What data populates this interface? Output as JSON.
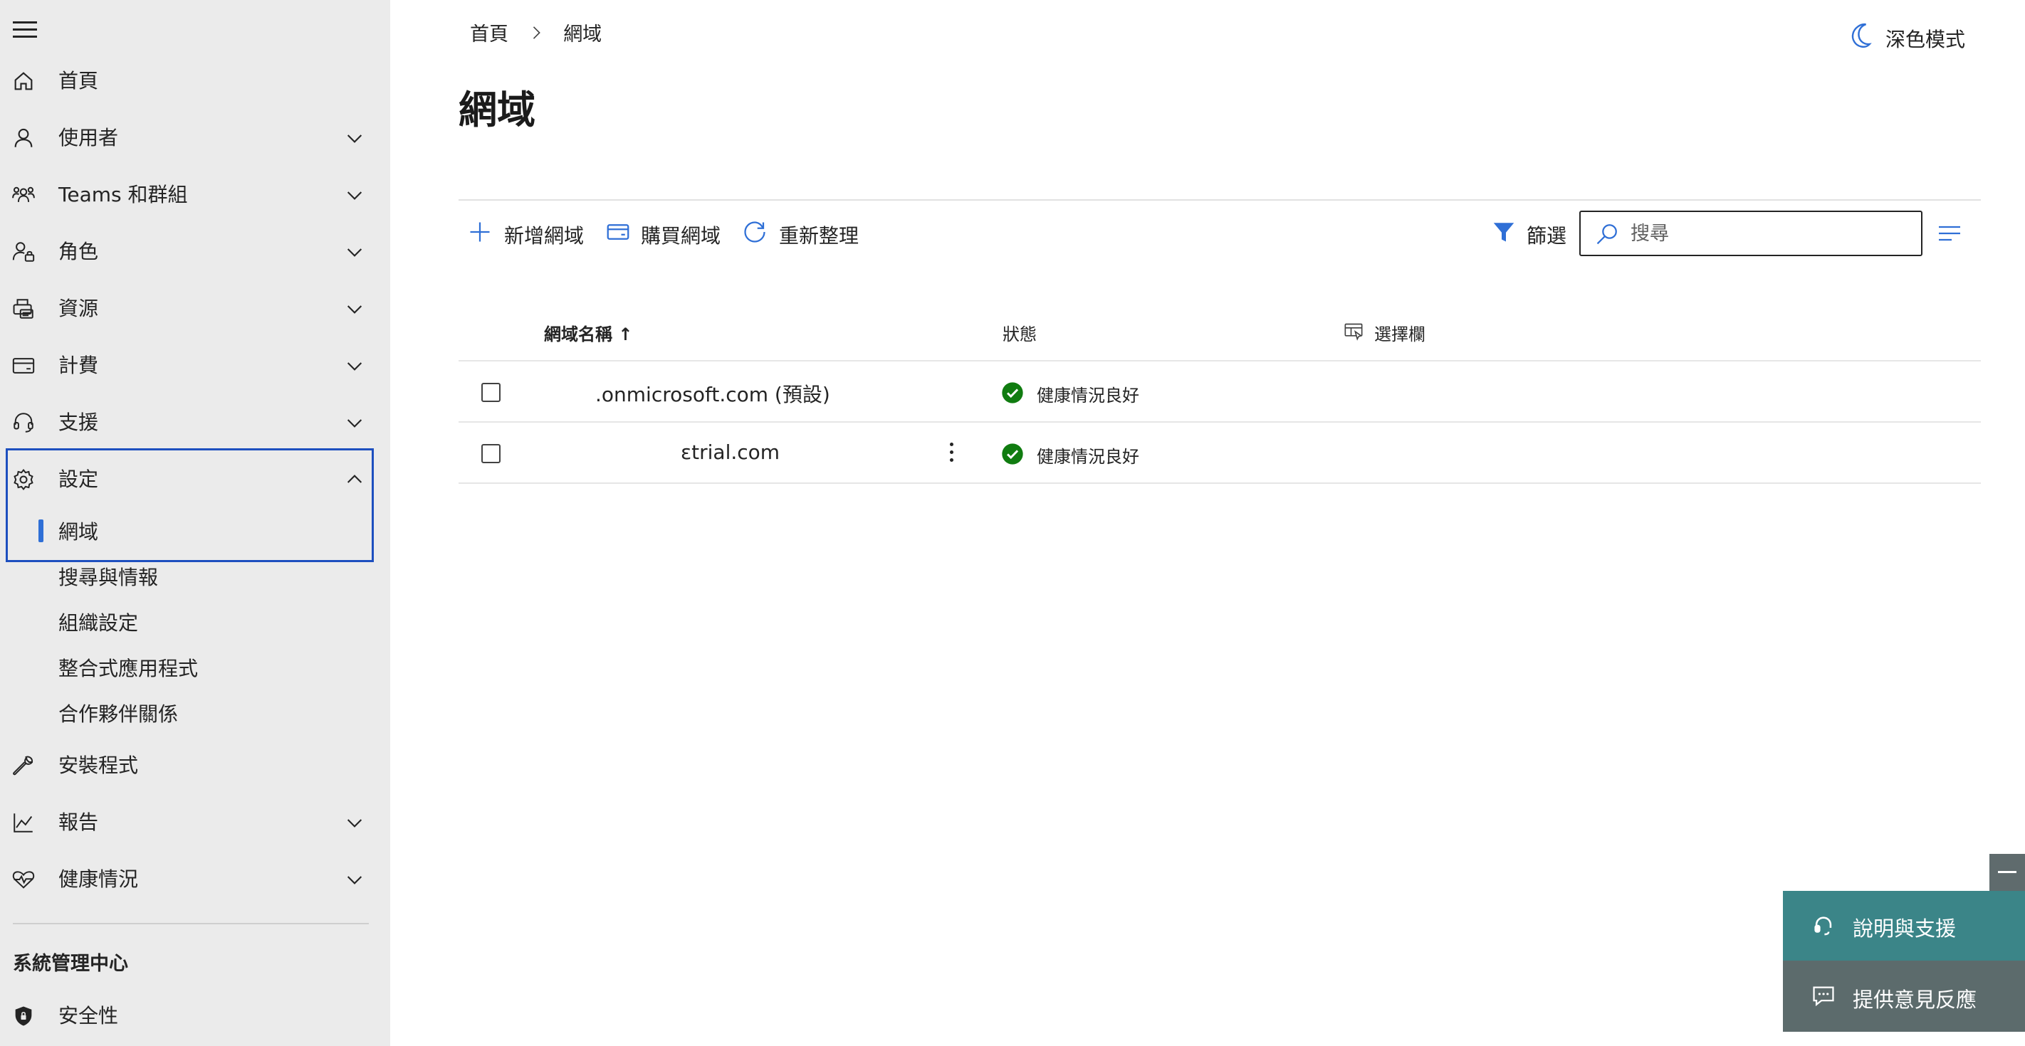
{
  "sidebar": {
    "items": [
      {
        "label": "首頁"
      },
      {
        "label": "使用者"
      },
      {
        "label": "Teams 和群組"
      },
      {
        "label": "角色"
      },
      {
        "label": "資源"
      },
      {
        "label": "計費"
      },
      {
        "label": "支援"
      },
      {
        "label": "設定"
      },
      {
        "label": "安裝程式"
      },
      {
        "label": "報告"
      },
      {
        "label": "健康情況"
      }
    ],
    "settings_sub": [
      {
        "label": "網域",
        "selected": true
      },
      {
        "label": "搜尋與情報"
      },
      {
        "label": "組織設定"
      },
      {
        "label": "整合式應用程式"
      },
      {
        "label": "合作夥伴關係"
      }
    ],
    "section_title": "系統管理中心",
    "section_items": [
      {
        "label": "安全性"
      }
    ]
  },
  "breadcrumb": [
    "首頁",
    "網域"
  ],
  "header": {
    "dark_mode_label": "深色模式"
  },
  "page": {
    "title": "網域"
  },
  "toolbar": {
    "add_label": "新增網域",
    "buy_label": "購買網域",
    "refresh_label": "重新整理",
    "filter_label": "篩選",
    "search_placeholder": "搜尋"
  },
  "table": {
    "columns": {
      "name": "網域名稱 ↑",
      "status": "狀態",
      "choose": "選擇欄"
    },
    "rows": [
      {
        "name": ".onmicrosoft.com (預設)",
        "status": "健康情況良好"
      },
      {
        "name": "ɛtrial.com",
        "status": "健康情況良好"
      }
    ]
  },
  "floating": {
    "help_label": "說明與支援",
    "feedback_label": "提供意見反應"
  },
  "colors": {
    "sidebar_bg": "#ebebeb",
    "accent_blue": "#2f6fd6",
    "focus_outline": "#1d4fbf",
    "success_green": "#107c10",
    "help_teal": "#3b8588",
    "feedback_gray": "#5c6b6c"
  }
}
